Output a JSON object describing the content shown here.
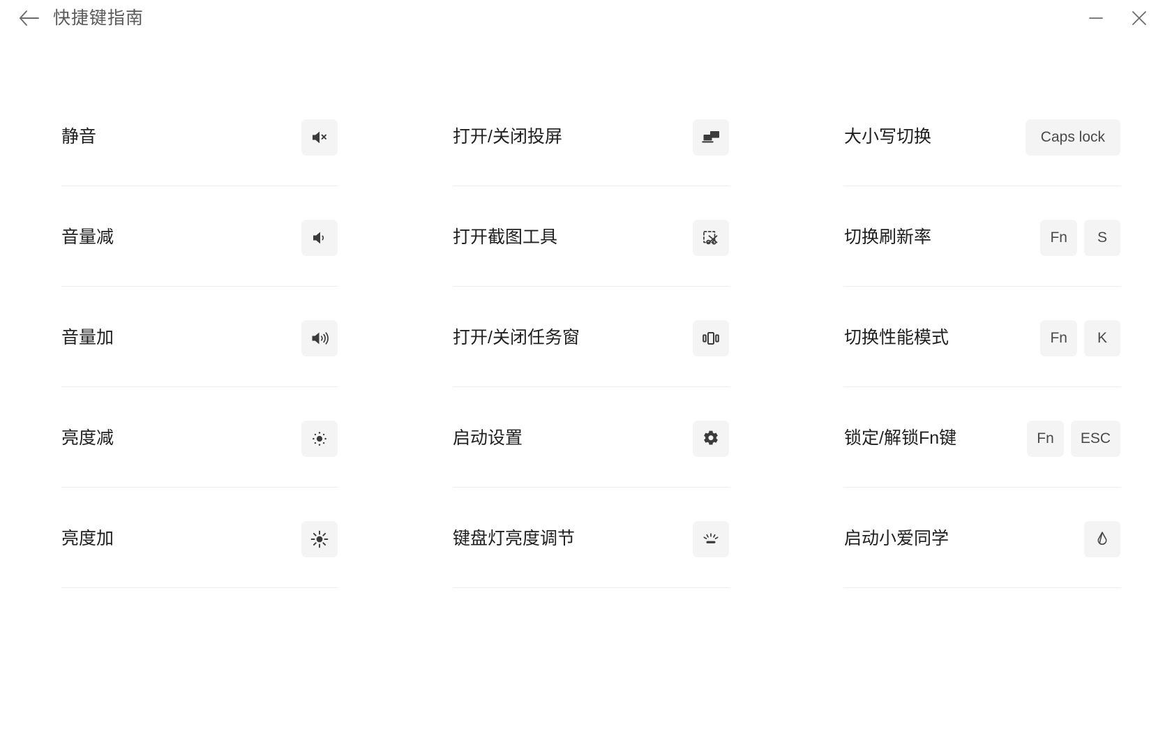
{
  "window": {
    "title": "快捷键指南",
    "back_icon": "arrow-left-icon",
    "minimize_label": "—",
    "close_label": "✕",
    "background": "#ffffff",
    "tile_background": "#f4f4f4",
    "divider_color": "#ececec",
    "text_color": "#1f1f1f",
    "title_color": "#5a5a5a"
  },
  "columns": [
    {
      "id": "column-1",
      "rows": [
        {
          "label": "静音",
          "type": "icon",
          "icon": "speaker-mute-icon"
        },
        {
          "label": "音量减",
          "type": "icon",
          "icon": "speaker-low-icon"
        },
        {
          "label": "音量加",
          "type": "icon",
          "icon": "speaker-high-icon"
        },
        {
          "label": "亮度减",
          "type": "icon",
          "icon": "brightness-low-icon"
        },
        {
          "label": "亮度加",
          "type": "icon",
          "icon": "brightness-high-icon"
        }
      ]
    },
    {
      "id": "column-2",
      "rows": [
        {
          "label": "打开/关闭投屏",
          "type": "icon",
          "icon": "cast-screen-icon"
        },
        {
          "label": "打开截图工具",
          "type": "icon",
          "icon": "snip-scissors-icon"
        },
        {
          "label": "打开/关闭任务窗",
          "type": "icon",
          "icon": "task-view-icon"
        },
        {
          "label": "启动设置",
          "type": "icon",
          "icon": "gear-icon"
        },
        {
          "label": "键盘灯亮度调节",
          "type": "icon",
          "icon": "keyboard-backlight-icon"
        }
      ]
    },
    {
      "id": "column-3",
      "rows": [
        {
          "label": "大小写切换",
          "type": "keys",
          "keys": [
            "Caps lock"
          ]
        },
        {
          "label": "切换刷新率",
          "type": "keys",
          "keys": [
            "Fn",
            "S"
          ]
        },
        {
          "label": "切换性能模式",
          "type": "keys",
          "keys": [
            "Fn",
            "K"
          ]
        },
        {
          "label": "锁定/解锁Fn键",
          "type": "keys",
          "keys": [
            "Fn",
            "ESC"
          ]
        },
        {
          "label": "启动小爱同学",
          "type": "icon",
          "icon": "xiaoai-assistant-icon"
        }
      ]
    }
  ]
}
